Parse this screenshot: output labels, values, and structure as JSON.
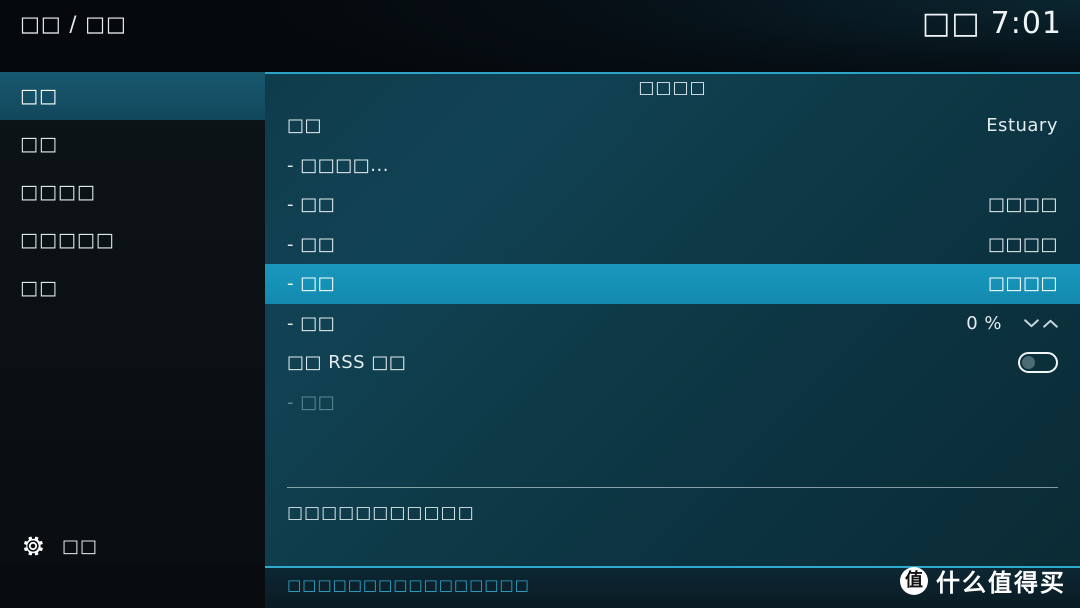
{
  "header": {
    "breadcrumb": "□□ / □□",
    "clock_day": "□□",
    "clock_time": "7:01"
  },
  "sidebar": {
    "items": [
      {
        "label": "□□",
        "selected": true
      },
      {
        "label": "□□",
        "selected": false
      },
      {
        "label": "□□□□",
        "selected": false
      },
      {
        "label": "□□□□□",
        "selected": false
      },
      {
        "label": "□□",
        "selected": false
      }
    ],
    "bottom": {
      "icon": "gear-icon",
      "label": "□□"
    }
  },
  "panel": {
    "title": "□□□□",
    "rows": [
      {
        "label": "□□",
        "value": "Estuary",
        "type": "value",
        "state": "normal"
      },
      {
        "label": "- □□□□...",
        "value": "",
        "type": "action",
        "state": "normal"
      },
      {
        "label": "- □□",
        "value": "□□□□",
        "type": "value",
        "state": "normal"
      },
      {
        "label": "- □□",
        "value": "□□□□",
        "type": "value",
        "state": "normal"
      },
      {
        "label": "- □□",
        "value": "□□□□",
        "type": "value",
        "state": "selected"
      },
      {
        "label": "- □□",
        "value": "0 %",
        "type": "spinner",
        "state": "normal"
      },
      {
        "label": "□□ RSS □□",
        "value": "",
        "type": "toggle",
        "toggle_on": false,
        "state": "normal"
      },
      {
        "label": "- □□",
        "value": "",
        "type": "value",
        "state": "disabled"
      }
    ],
    "description": "□□□□□□□□□□□",
    "footer_text": "□□□□□□□□□□□□□□□□"
  },
  "watermark": {
    "logo_char": "值",
    "text": "什么值得买"
  },
  "colors": {
    "accent": "#2fa9cd",
    "row_selected": "#1690b5",
    "sidebar_selected": "#154f65",
    "panel_bg": "#0f3c4c"
  }
}
